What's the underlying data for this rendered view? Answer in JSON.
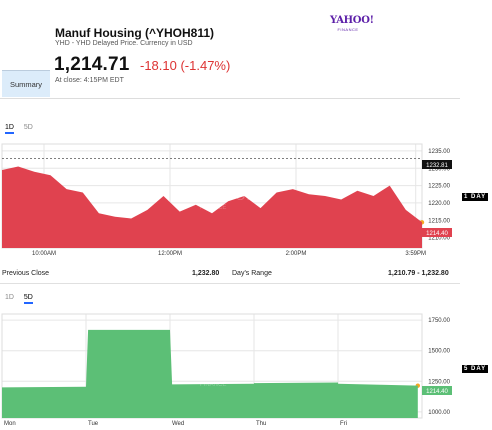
{
  "header": {
    "title": "Manuf Housing (^YHOH811)",
    "subtitle": "YHD - YHD Delayed Price. Currency in USD",
    "price": "1,214.71",
    "change": "-18.10 (-1.47%)",
    "close_time": "At close: 4:15PM EDT",
    "logo_main": "YAHOO!",
    "logo_sub": "FINANCE"
  },
  "tabs": {
    "summary": "Summary"
  },
  "chart1": {
    "range_tabs": [
      "1D",
      "5D"
    ],
    "active_tab": "1D",
    "side_label": "1 DAY",
    "watermark_main": "YAHOO!",
    "watermark_sub": "FINANCE",
    "y_ticks": [
      "1235.00",
      "1230.00",
      "1225.00",
      "1220.00",
      "1215.00",
      "1210.00"
    ],
    "x_ticks": [
      "10:00AM",
      "12:00PM",
      "2:00PM",
      "3:59PM"
    ],
    "prev_close_label": "1232.81",
    "last_label": "1214.40",
    "color": "#e0424f"
  },
  "stats": {
    "prev_close_label": "Previous Close",
    "prev_close_value": "1,232.80",
    "days_range_label": "Day's Range",
    "days_range_value": "1,210.79 - 1,232.80"
  },
  "chart2": {
    "range_tabs": [
      "1D",
      "5D"
    ],
    "active_tab": "5D",
    "side_label": "5 DAY",
    "watermark_main": "YAHOO!",
    "watermark_sub": "FINANCE",
    "y_ticks": [
      "1750.00",
      "1500.00",
      "1250.00",
      "1000.00"
    ],
    "x_ticks": [
      "Mon",
      "Tue",
      "Wed",
      "Thu",
      "Fri"
    ],
    "last_label": "1214.40",
    "color": "#5cbf76"
  },
  "chart_data": [
    {
      "type": "area",
      "title": "",
      "xlabel": "",
      "ylabel": "",
      "ylim": [
        1207,
        1237
      ],
      "x_ticks": [
        "10:00AM",
        "12:00PM",
        "2:00PM",
        "3:59PM"
      ],
      "x": [
        "9:30",
        "9:45",
        "10:00",
        "10:15",
        "10:30",
        "10:45",
        "11:00",
        "11:15",
        "11:30",
        "11:45",
        "12:00",
        "12:15",
        "12:30",
        "12:45",
        "13:00",
        "13:15",
        "13:30",
        "13:45",
        "14:00",
        "14:15",
        "14:30",
        "14:45",
        "15:00",
        "15:15",
        "15:30",
        "15:45",
        "15:59"
      ],
      "series": [
        {
          "values": [
            1229.5,
            1230.5,
            1229.0,
            1228.0,
            1224.0,
            1223.0,
            1217.0,
            1216.0,
            1215.5,
            1218.0,
            1222.0,
            1217.5,
            1219.5,
            1217.0,
            1220.5,
            1222.0,
            1218.5,
            1223.0,
            1224.0,
            1222.5,
            1222.0,
            1221.0,
            1223.5,
            1222.0,
            1225.0,
            1218.0,
            1214.4
          ]
        }
      ],
      "reference_line": 1232.81,
      "grid": true
    },
    {
      "type": "area",
      "title": "",
      "xlabel": "",
      "ylabel": "",
      "ylim": [
        950,
        1800
      ],
      "x_ticks": [
        "Mon",
        "Tue",
        "Wed",
        "Thu",
        "Fri"
      ],
      "x": [
        "Mon",
        "Mon-mid",
        "Tue",
        "Tue-mid",
        "Tue-end",
        "Wed",
        "Wed-mid",
        "Thu",
        "Thu-mid",
        "Fri",
        "Fri-mid",
        "Fri-end"
      ],
      "series": [
        {
          "values": [
            1200,
            1205,
            1670,
            1670,
            1665,
            1225,
            1230,
            1235,
            1240,
            1230,
            1222,
            1214.4
          ]
        }
      ],
      "grid": true
    }
  ]
}
